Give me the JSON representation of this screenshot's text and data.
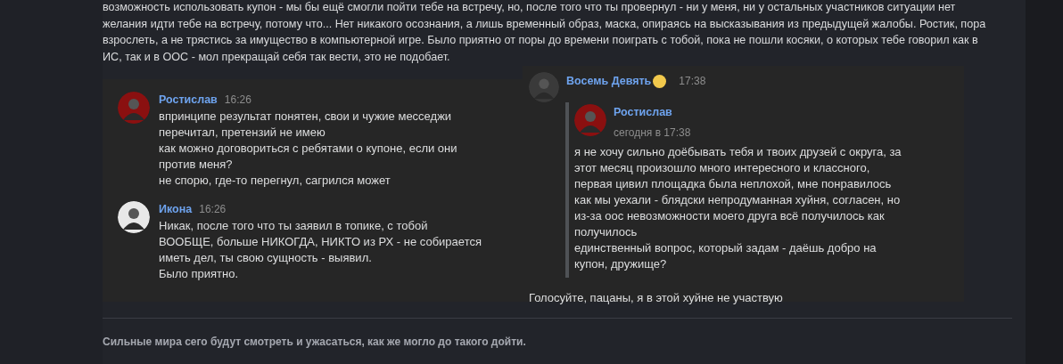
{
  "post": {
    "lines": [
      "возможность использовать купон - мы бы ещё смогли пойти тебе на встречу, но, после того что ты провернул - ни у меня, ни у остальных участников ситуации нет",
      "желания идти тебе на встречу, потому что... Нет никакого осознания, а лишь временный образ, маска, опираясь на высказывания из предыдущей жалобы. Ростик, пора",
      "взрослеть, а не трястись за имущество в компьютерной игре. Было приятно от поры до времени поиграть с тобой, пока не пошли косяки, о которых тебе говорил как в",
      "ИС, так и в ООС - мол прекращай себя так вести, это не подобает."
    ]
  },
  "screenshot_left": {
    "messages": [
      {
        "author": "Ростислав",
        "time": "16:26",
        "color": "#8a1010",
        "lines": [
          "впринципе результат понятен, свои и чужие месседжи",
          "перечитал, претензий не имею",
          "как можно договориться с ребятами о купоне, если они",
          "против меня?",
          "не спорю, где-то перегнул, сагрился может"
        ]
      },
      {
        "author": "Икона",
        "time": "16:26",
        "color": "#e8e8e8",
        "lines": [
          "Никак, после того что ты заявил в топике, с тобой",
          "ВООБЩЕ, больше НИКОГДА, НИКТО из РХ - не собирается",
          "иметь дел, ты свою сущность - выявил.",
          "Было приятно."
        ]
      }
    ]
  },
  "screenshot_right": {
    "author": "Восемь Девять",
    "time": "17:38",
    "color": "#3a3a3a",
    "quote": {
      "author": "Ростислав",
      "time": "сегодня в 17:38",
      "color": "#8a1010",
      "lines": [
        "я не хочу сильно доёбывать тебя и твоих друзей с округа, за",
        "этот месяц произошло много интересного и классного,",
        "первая цивил площадка была неплохой, мне понравилось",
        "как мы уехали - блядски непродуманная хуйня, согласен, но",
        "из-за оос невозможности моего друга всё получилось как",
        "получилось",
        "единственный вопрос, который задам - даёшь добро на",
        "купон, дружище?"
      ]
    },
    "text": "Голосуйте, пацаны, я в этой хуйне не участвую"
  },
  "signature": "Сильные мира сего будут смотреть и ужасаться, как же могло до такого дойти."
}
